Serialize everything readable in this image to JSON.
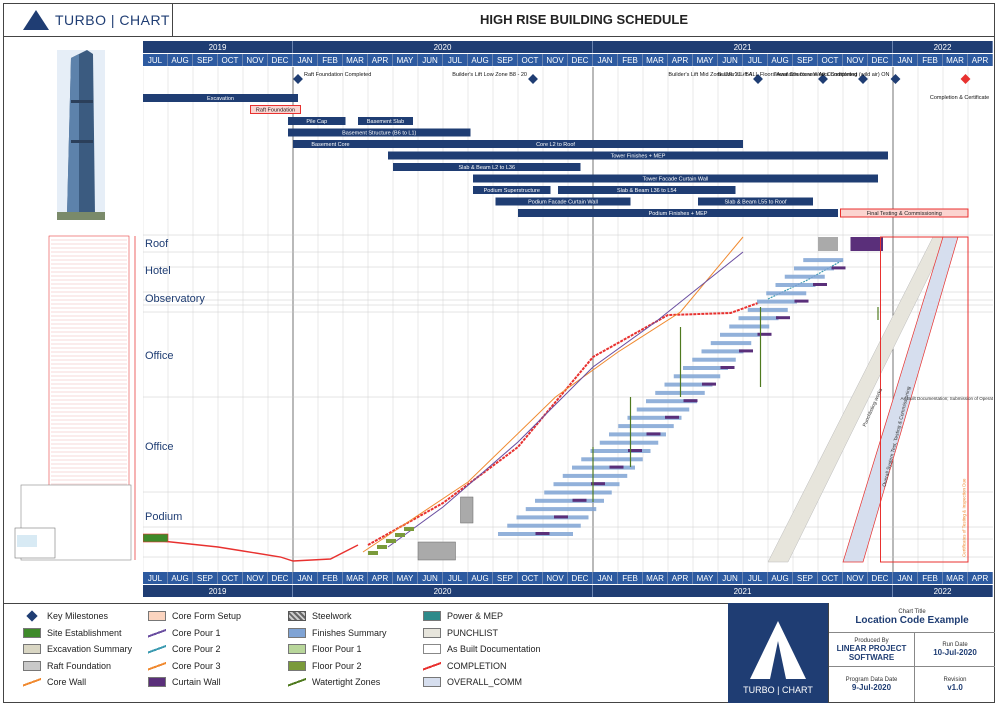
{
  "header": {
    "logo_text": "TURBO | CHART",
    "title": "HIGH RISE BUILDING SCHEDULE"
  },
  "colors": {
    "navy": "#1f3d73",
    "accent_red": "#e8312f",
    "bar_blue": "#1f3d73"
  },
  "chart_data": {
    "type": "table",
    "timeline": {
      "years": [
        {
          "label": "2019",
          "span": 6
        },
        {
          "label": "2020",
          "span": 12
        },
        {
          "label": "2021",
          "span": 12
        },
        {
          "label": "2022",
          "span": 4
        }
      ],
      "months": [
        "JUL",
        "AUG",
        "SEP",
        "OCT",
        "NOV",
        "DEC",
        "JAN",
        "FEB",
        "MAR",
        "APR",
        "MAY",
        "JUN",
        "JUL",
        "AUG",
        "SEP",
        "OCT",
        "NOV",
        "DEC",
        "JAN",
        "FEB",
        "MAR",
        "APR",
        "MAY",
        "JUN",
        "JUL",
        "AUG",
        "SEP",
        "OCT",
        "NOV",
        "DEC",
        "JAN",
        "FEB",
        "MAR",
        "APR"
      ]
    },
    "milestones": [
      {
        "label": "Raft Foundation Completed",
        "month": 6.2
      },
      {
        "label": "Builder's Lift Low Zone B8 - 20",
        "month": 15.6
      },
      {
        "label": "Builder's Lift Mid Zone LVL 21 - 54",
        "month": 24.6
      },
      {
        "label": "Builder's Lift ALL Floors Available for use",
        "month": 27.2
      },
      {
        "label": "Tower Structure Works Completed",
        "month": 28.8
      },
      {
        "label": "Air Conditioning (wild air) ON",
        "month": 30.1
      },
      {
        "label": "Completion & Certificate",
        "month": 32.9
      }
    ],
    "activities": [
      {
        "label": "Excavation",
        "start": 0,
        "end": 6.2,
        "row": 0
      },
      {
        "label": "Raft Foundation",
        "start": 4.3,
        "end": 6.3,
        "row": 1,
        "highlight": true
      },
      {
        "label": "Pile Cap",
        "start": 5.8,
        "end": 8.1,
        "row": 2
      },
      {
        "label": "Basement Slab",
        "start": 8.6,
        "end": 10.8,
        "row": 2
      },
      {
        "label": "Basement Structure (B6 to L1)",
        "start": 5.8,
        "end": 13.1,
        "row": 3
      },
      {
        "label": "Basement Core",
        "start": 6.0,
        "end": 9.0,
        "row": 4
      },
      {
        "label": "Core L2 to Roof",
        "start": 9.0,
        "end": 24.0,
        "row": 4
      },
      {
        "label": "Tower Finishes + MEP",
        "start": 9.8,
        "end": 29.8,
        "row": 5
      },
      {
        "label": "Slab & Beam L2 to L36",
        "start": 10.0,
        "end": 17.5,
        "row": 6
      },
      {
        "label": "Tower Facade Curtain Wall",
        "start": 13.2,
        "end": 29.4,
        "row": 7
      },
      {
        "label": "Podium Superstructure",
        "start": 13.2,
        "end": 16.3,
        "row": 8
      },
      {
        "label": "Slab & Beam L36 to L54",
        "start": 16.6,
        "end": 23.7,
        "row": 8
      },
      {
        "label": "Podium Facade Curtain Wall",
        "start": 14.1,
        "end": 19.5,
        "row": 9
      },
      {
        "label": "Slab & Beam L55 to Roof",
        "start": 22.2,
        "end": 26.8,
        "row": 9
      },
      {
        "label": "Podium Finishes + MEP",
        "start": 15.0,
        "end": 27.8,
        "row": 10
      },
      {
        "label": "Final Testing & Commissioning",
        "start": 27.9,
        "end": 33.0,
        "row": 10,
        "highlight": true
      }
    ],
    "location_labels": [
      "Roof",
      "Hotel",
      "Observatory",
      "Office",
      "Office",
      "Podium"
    ],
    "diagonal_labels": [
      "Punchlisting works",
      "Overall System Test, Testing & Commissioning",
      "As Built Documentation; Submission of Operation & Maintenance Manuals",
      "Certificates of Testing & Inspection Due"
    ]
  },
  "legend": [
    {
      "label": "Key Milestones",
      "swatch": "diamond",
      "color": "#1f3d73"
    },
    {
      "label": "Site Establishment",
      "swatch": "fill",
      "color": "#3e8a2a"
    },
    {
      "label": "Excavation Summary",
      "swatch": "fill",
      "color": "#d9d6c3"
    },
    {
      "label": "Raft Foundation",
      "swatch": "fill",
      "color": "#c9c9c9"
    },
    {
      "label": "Core Wall",
      "swatch": "line",
      "color": "#f08a30"
    },
    {
      "label": "Core Form Setup",
      "swatch": "fill",
      "color": "#fbd4bf"
    },
    {
      "label": "Core Pour 1",
      "swatch": "line",
      "color": "#6a4ea0"
    },
    {
      "label": "Core Pour 2",
      "swatch": "line",
      "color": "#3b9ab0"
    },
    {
      "label": "Core Pour 3",
      "swatch": "line",
      "color": "#f08a30"
    },
    {
      "label": "Curtain Wall",
      "swatch": "fill",
      "color": "#5a2f7a"
    },
    {
      "label": "Steelwork",
      "swatch": "hatch",
      "color": "#888888"
    },
    {
      "label": "Finishes Summary",
      "swatch": "fill",
      "color": "#7fa3d4"
    },
    {
      "label": "Floor Pour 1",
      "swatch": "fill",
      "color": "#b8d69a"
    },
    {
      "label": "Floor Pour 2",
      "swatch": "fill",
      "color": "#7a9a3a"
    },
    {
      "label": "Watertight Zones",
      "swatch": "line",
      "color": "#4f7a1f"
    },
    {
      "label": "Power & MEP",
      "swatch": "fill",
      "color": "#2e8a8a"
    },
    {
      "label": "PUNCHLIST",
      "swatch": "fill",
      "color": "#e7e5dc"
    },
    {
      "label": "As Built Documentation",
      "swatch": "outline",
      "color": "#888888"
    },
    {
      "label": "COMPLETION",
      "swatch": "line",
      "color": "#e8312f"
    },
    {
      "label": "OVERALL_COMM",
      "swatch": "fill",
      "color": "#d6deee"
    }
  ],
  "info": {
    "logo_text": "TURBO | CHART",
    "chart_title_label": "Chart Title",
    "chart_title": "Location Code Example",
    "produced_by_label": "Produced By",
    "produced_by": "LINEAR PROJECT SOFTWARE",
    "run_date_label": "Run Date",
    "run_date": "10-Jul-2020",
    "program_date_label": "Program Data Date",
    "program_date": "9-Jul-2020",
    "revision_label": "Revision",
    "revision": "v1.0"
  }
}
